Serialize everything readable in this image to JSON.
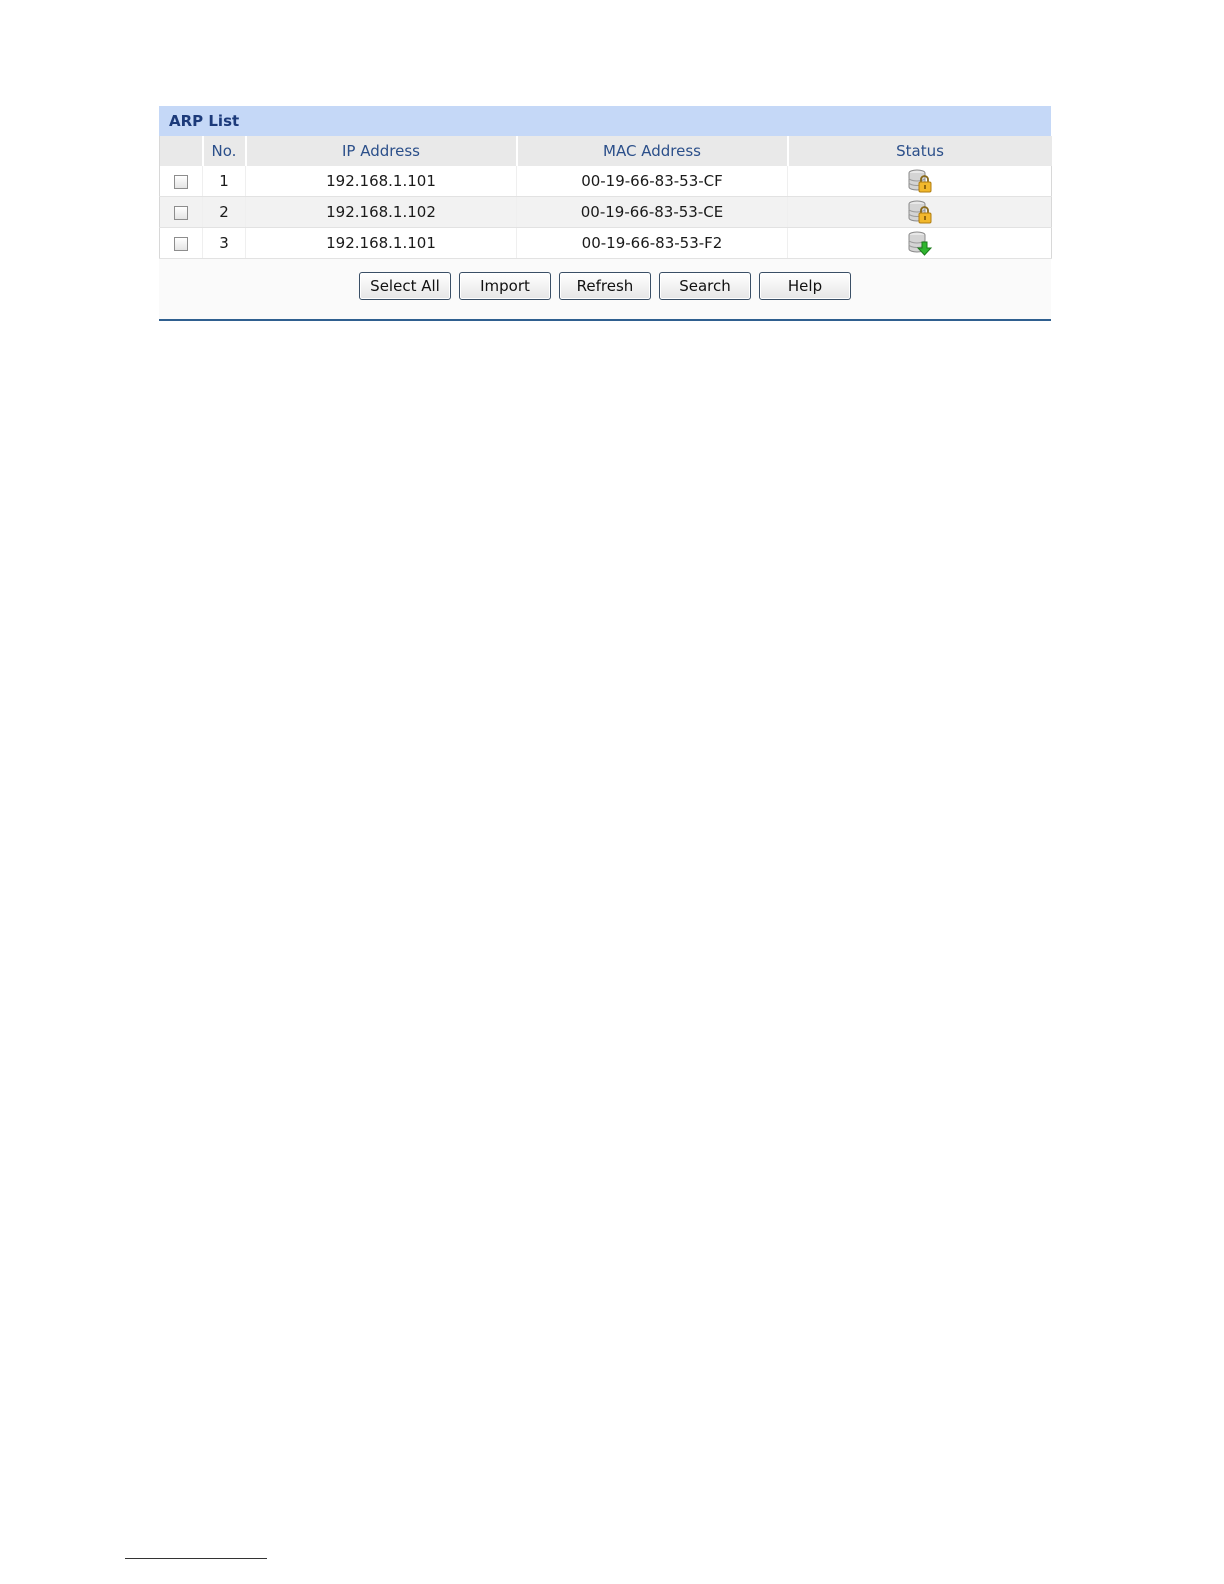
{
  "panel": {
    "title": "ARP List"
  },
  "table": {
    "columns": [
      "",
      "No.",
      "IP Address",
      "MAC Address",
      "Status"
    ],
    "rows": [
      {
        "no": "1",
        "ip": "192.168.1.101",
        "mac": "00-19-66-83-53-CF",
        "status_icon": "locked-server-icon"
      },
      {
        "no": "2",
        "ip": "192.168.1.102",
        "mac": "00-19-66-83-53-CE",
        "status_icon": "locked-server-icon"
      },
      {
        "no": "3",
        "ip": "192.168.1.101",
        "mac": "00-19-66-83-53-F2",
        "status_icon": "download-server-icon"
      }
    ]
  },
  "buttons": {
    "select_all": "Select All",
    "import": "Import",
    "refresh": "Refresh",
    "search": "Search",
    "help": "Help"
  },
  "colors": {
    "title_bar": "#c5d8f7",
    "title_text": "#1c3a7a",
    "header_text": "#2b4f8a",
    "bottom_rule": "#2f5f8f"
  }
}
